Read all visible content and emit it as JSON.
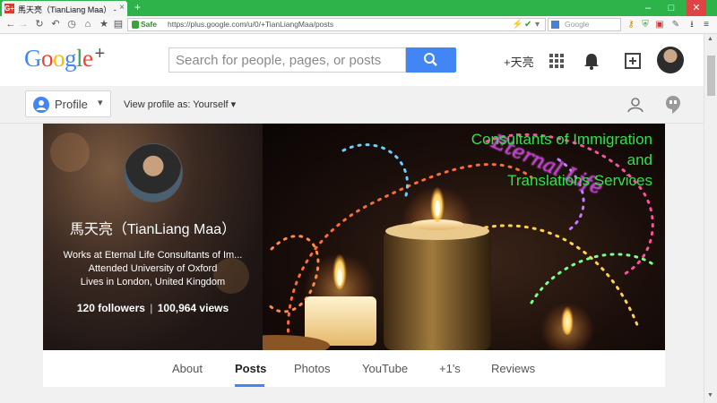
{
  "browser": {
    "tab_title": "馬天亮（TianLiang Maa） - Go...",
    "tab_favicon": "G+",
    "address": {
      "safe_label": "Safe",
      "url": "https://plus.google.com/u/0/+TianLiangMaa/posts"
    },
    "search_placeholder": "Google"
  },
  "gplus": {
    "logo": {
      "letters": [
        "G",
        "o",
        "o",
        "g",
        "l",
        "e",
        "+"
      ],
      "colors": [
        "#4285f4",
        "#ea4335",
        "#fbbc05",
        "#4285f4",
        "#34a853",
        "#ea4335",
        "#555555"
      ]
    },
    "search_placeholder": "Search for people, pages, or posts",
    "user_link": "+天亮"
  },
  "profile_bar": {
    "profile_label": "Profile",
    "view_as_label": "View profile as:",
    "view_as_value": "Yourself"
  },
  "profile": {
    "name": "馬天亮（TianLiang Maa）",
    "work": "Works at Eternal Life Consultants of Im...",
    "education": "Attended University of Oxford",
    "location": "Lives in London, United Kingdom",
    "followers": "120 followers",
    "views": "100,964 views"
  },
  "cover": {
    "script_title": "Eternal Life",
    "lines": [
      "Consultants of Immigration",
      "and",
      "Translations Services"
    ]
  },
  "tabs": [
    "About",
    "Posts",
    "Photos",
    "YouTube",
    "+1's",
    "Reviews"
  ],
  "active_tab": "Posts",
  "colors": {
    "browser_green": "#2db34a",
    "accent_blue": "#4285f4",
    "cover_text_green": "#34e04a",
    "cover_script_purple": "#c03fd1"
  }
}
